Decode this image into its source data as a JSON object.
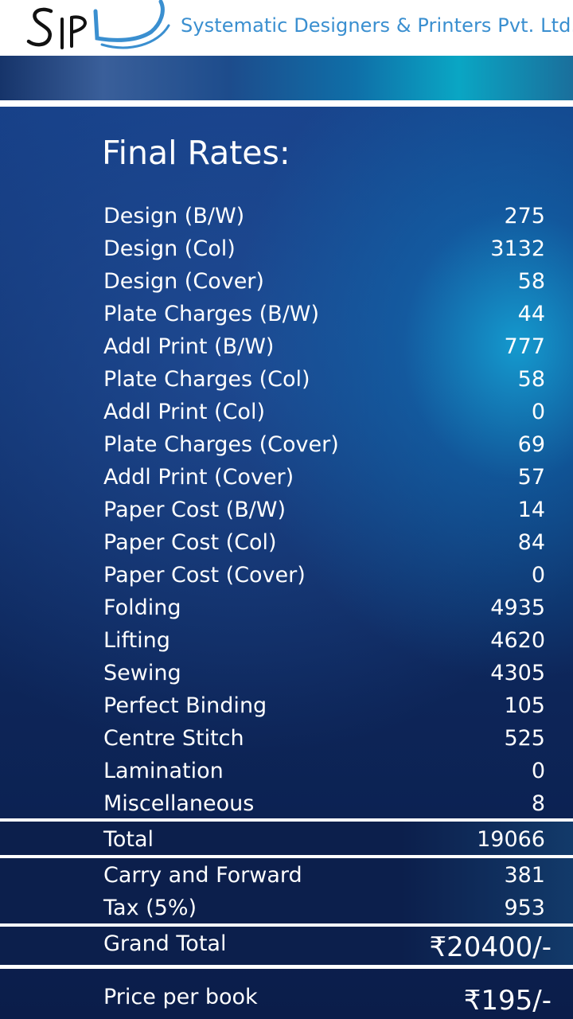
{
  "header": {
    "logo_text": "SPL",
    "company_name": "Systematic Designers & Printers Pvt. Ltd."
  },
  "title": "Final Rates:",
  "rates": [
    {
      "label": "Design (B/W)",
      "value": "275"
    },
    {
      "label": "Design (Col)",
      "value": "3132"
    },
    {
      "label": "Design (Cover)",
      "value": "58"
    },
    {
      "label": "Plate Charges (B/W)",
      "value": "44"
    },
    {
      "label": "Addl Print (B/W)",
      "value": "777"
    },
    {
      "label": "Plate Charges (Col)",
      "value": "58"
    },
    {
      "label": "Addl Print (Col)",
      "value": "0"
    },
    {
      "label": "Plate Charges (Cover)",
      "value": "69"
    },
    {
      "label": "Addl Print (Cover)",
      "value": "57"
    },
    {
      "label": "Paper Cost (B/W)",
      "value": "14"
    },
    {
      "label": "Paper Cost (Col)",
      "value": "84"
    },
    {
      "label": "Paper Cost (Cover)",
      "value": "0"
    },
    {
      "label": "Folding",
      "value": "4935"
    },
    {
      "label": "Lifting",
      "value": "4620"
    },
    {
      "label": "Sewing",
      "value": "4305"
    },
    {
      "label": "Perfect Binding",
      "value": "105"
    },
    {
      "label": "Centre Stitch",
      "value": "525"
    },
    {
      "label": "Lamination",
      "value": "0"
    },
    {
      "label": "Miscellaneous",
      "value": "8"
    }
  ],
  "total": {
    "label": "Total",
    "value": "19066"
  },
  "carry_forward": {
    "label": "Carry and Forward",
    "value": "381"
  },
  "tax": {
    "label": "Tax (5%)",
    "value": "953"
  },
  "grand_total": {
    "label": "Grand Total",
    "value": "₹20400/-"
  },
  "price_per_book": {
    "label": "Price per book",
    "value": "₹195/-"
  }
}
